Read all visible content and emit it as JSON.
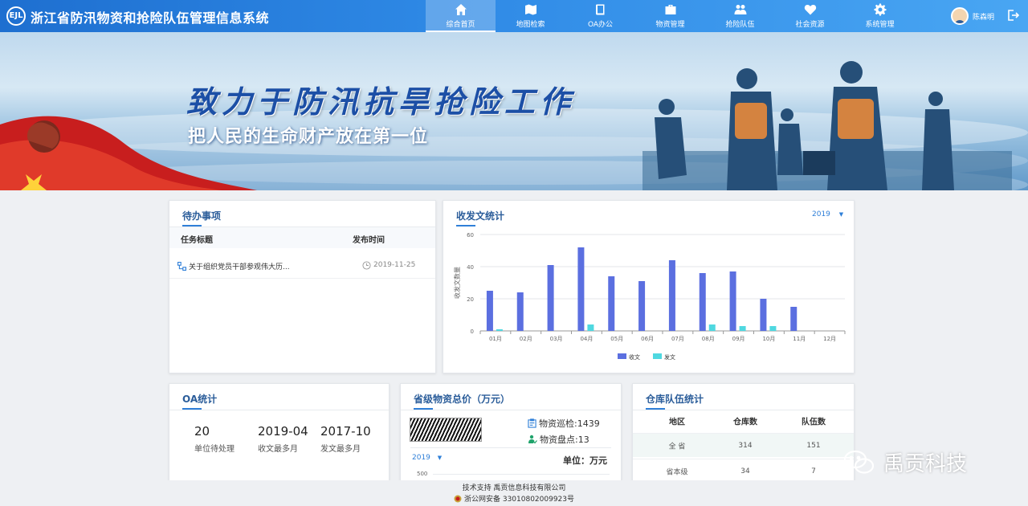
{
  "header": {
    "logo_text": "EJL",
    "title": "浙江省防汛物资和抢险队伍管理信息系统",
    "nav": [
      {
        "label": "综合首页",
        "icon": "home-icon",
        "active": true
      },
      {
        "label": "地图检索",
        "icon": "map-icon"
      },
      {
        "label": "OA办公",
        "icon": "book-icon"
      },
      {
        "label": "物资管理",
        "icon": "briefcase-icon"
      },
      {
        "label": "抢险队伍",
        "icon": "team-icon"
      },
      {
        "label": "社会资源",
        "icon": "heart-icon"
      },
      {
        "label": "系统管理",
        "icon": "gear-icon"
      }
    ],
    "user_name": "陈森明"
  },
  "banner": {
    "title": "致力于防汛抗旱抢险工作",
    "subtitle": "把人民的生命财产放在第一位",
    "slides": 4,
    "active_slide": 0
  },
  "todo": {
    "title": "待办事项",
    "col_title": "任务标题",
    "col_time": "发布时间",
    "rows": [
      {
        "title": "关于组织党员干部参观伟大历...",
        "time": "2019-11-25"
      }
    ]
  },
  "doc_stats": {
    "title": "收发文统计",
    "year": "2019"
  },
  "chart_data": {
    "type": "bar",
    "title": "",
    "xlabel": "",
    "ylabel": "收发文数量",
    "ylim": [
      0,
      60
    ],
    "yticks": [
      0,
      20,
      40,
      60
    ],
    "categories": [
      "01月",
      "02月",
      "03月",
      "04月",
      "05月",
      "06月",
      "07月",
      "08月",
      "09月",
      "10月",
      "11月",
      "12月"
    ],
    "series": [
      {
        "name": "收文",
        "color": "#5b6fe0",
        "values": [
          25,
          24,
          41,
          52,
          34,
          31,
          44,
          36,
          37,
          20,
          15,
          0
        ]
      },
      {
        "name": "发文",
        "color": "#4fd8e0",
        "values": [
          1,
          0,
          0,
          4,
          0,
          0,
          0,
          4,
          3,
          3,
          0,
          0
        ]
      }
    ],
    "grid": true,
    "legend": "bottom"
  },
  "oa": {
    "title": "OA统计",
    "stats": [
      {
        "value": "20",
        "label": "单位待处理"
      },
      {
        "value": "2019-04",
        "label": "收文最多月"
      },
      {
        "value": "2017-10",
        "label": "发文最多月"
      }
    ]
  },
  "materials": {
    "title": "省级物资总价（万元）",
    "inspect_label": "物资巡检:",
    "inspect_value": "1439",
    "inventory_label": "物资盘点:",
    "inventory_value": "13",
    "unit": "单位：万元",
    "year": "2019",
    "axis_top": "500"
  },
  "warehouse": {
    "title": "仓库队伍统计",
    "headers": [
      "地区",
      "仓库数",
      "队伍数"
    ],
    "rows": [
      [
        "全 省",
        "314",
        "151"
      ],
      [
        "省本级",
        "34",
        "7"
      ]
    ]
  },
  "footer": {
    "line1": "技术支持 禹贡信息科技有限公司",
    "line2": "浙公网安备 33010802009923号"
  },
  "watermark": "禹贡科技",
  "colors": {
    "header_start": "#1e6fd0",
    "accent": "#2f7fd8",
    "received": "#5b6fe0",
    "sent": "#4fd8e0"
  }
}
